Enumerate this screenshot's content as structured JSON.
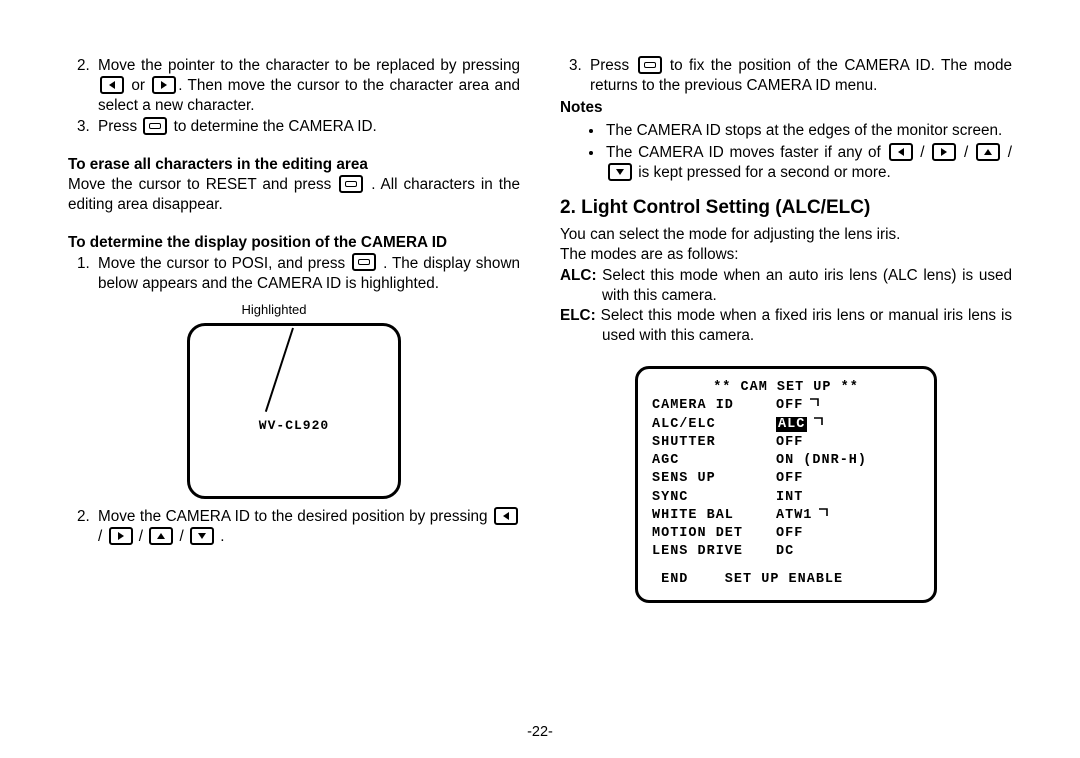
{
  "left": {
    "item2": "Move the pointer to the character to be replaced by pressing {L} or {R}. Then move the cursor to the character area and select a new character.",
    "item3_pre": "Press ",
    "item3_post": " to determine the CAMERA ID.",
    "erase_heading": "To erase all characters in the editing area",
    "erase_text_pre": "Move the cursor to RESET and press ",
    "erase_text_post": ". All charac­ters in the editing area disappear.",
    "posi_heading": "To determine the display position of the CAMERA ID",
    "posi_item1_pre": "Move the cursor to POSI, and press ",
    "posi_item1_post": ". The dis­play shown below appears and the CAMERA ID is highlighted.",
    "fig_caption": "Highlighted",
    "fig_model": "WV-CL920",
    "posi_item2_pre": "Move the CAMERA ID to the desired position by pressing ",
    "posi_item2_post": "."
  },
  "right": {
    "item3_pre": "Press ",
    "item3_post": " to fix the position of the CAMERA ID. The mode returns to the previous CAMERA ID menu.",
    "notes_heading": "Notes",
    "note1": "The CAMERA ID stops at the edges of the monitor screen.",
    "note2_pre": "The CAMERA ID moves faster if any of ",
    "note2_post": " is kept pressed for a second or more.",
    "section_heading": "2. Light Control Setting (ALC/ELC)",
    "intro1": "You can select the mode for adjusting the lens iris.",
    "intro2": "The modes are as follows:",
    "alc_label": "ALC:",
    "alc_text": " Select this mode when an auto iris lens (ALC lens) is used with this camera.",
    "elc_label": "ELC:",
    "elc_text": " Select this mode when a fixed iris lens or manual iris lens is used with this camera."
  },
  "setup": {
    "title": "** CAM SET UP **",
    "rows": [
      {
        "label": "CAMERA ID",
        "value": "OFF",
        "hook": true
      },
      {
        "label": "ALC/ELC",
        "value": "ALC",
        "highlighted": true,
        "hook": true
      },
      {
        "label": "SHUTTER",
        "value": "OFF"
      },
      {
        "label": "AGC",
        "value": "ON (DNR-H)"
      },
      {
        "label": "SENS UP",
        "value": "OFF"
      },
      {
        "label": "SYNC",
        "value": "INT"
      },
      {
        "label": "WHITE BAL",
        "value": "ATW1",
        "hook": true
      },
      {
        "label": "MOTION DET",
        "value": "OFF"
      },
      {
        "label": "LENS DRIVE",
        "value": "DC"
      }
    ],
    "footer": " END    SET UP ENABLE"
  },
  "page_number": "-22-"
}
